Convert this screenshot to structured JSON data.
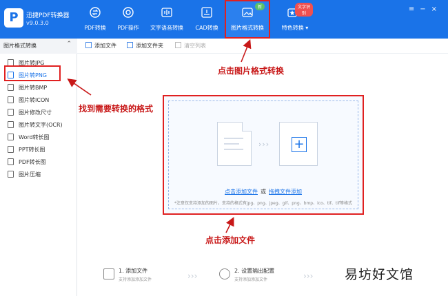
{
  "app": {
    "name": "迅捷PDF转换器",
    "version": "v9.0.3.0"
  },
  "nav": [
    {
      "label": "PDF转换",
      "icon": "swap-icon"
    },
    {
      "label": "PDF操作",
      "icon": "target-icon"
    },
    {
      "label": "文字语音转换",
      "icon": "audio-icon"
    },
    {
      "label": "CAD转换",
      "icon": "cad-icon"
    },
    {
      "label": "图片格式转换",
      "icon": "image-icon",
      "badge": "新"
    },
    {
      "label": "特色转换",
      "icon": "star-icon",
      "badge": "文字识别"
    }
  ],
  "sidebar": {
    "header": "图片格式转换",
    "items": [
      {
        "label": "图片转JPG"
      },
      {
        "label": "图片转PNG"
      },
      {
        "label": "图片转BMP"
      },
      {
        "label": "图片转ICON"
      },
      {
        "label": "图片修改尺寸"
      },
      {
        "label": "图片转文字(OCR)"
      },
      {
        "label": "Word转长图"
      },
      {
        "label": "PPT转长图"
      },
      {
        "label": "PDF转长图"
      },
      {
        "label": "图片压缩"
      }
    ]
  },
  "toolbar": {
    "add_file": "添加文件",
    "add_folder": "添加文件夹",
    "clear_list": "清空列表"
  },
  "drop": {
    "click_add": "点击添加文件",
    "or": "或",
    "drag_here": "拖拽文件添加",
    "hint": "*注意仅支持添加的图片，支持的格式有jpg、png、jpeg、gif、png、bmp、ico、tif、tif等格式"
  },
  "steps": [
    {
      "title": "1. 添加文件",
      "sub": "支持添加添加文件"
    },
    {
      "title": "2. 设置输出配置",
      "sub": "支持添加添加文件"
    }
  ],
  "annotations": {
    "click_image_format": "点击图片格式转换",
    "find_format": "找到需要转换的格式",
    "click_add_file": "点击添加文件"
  },
  "watermark": "易坊好文馆",
  "colors": {
    "brand": "#1a73e8",
    "annotation": "#c81818",
    "badge_green": "#5cc16a",
    "badge_red": "#f05050"
  }
}
